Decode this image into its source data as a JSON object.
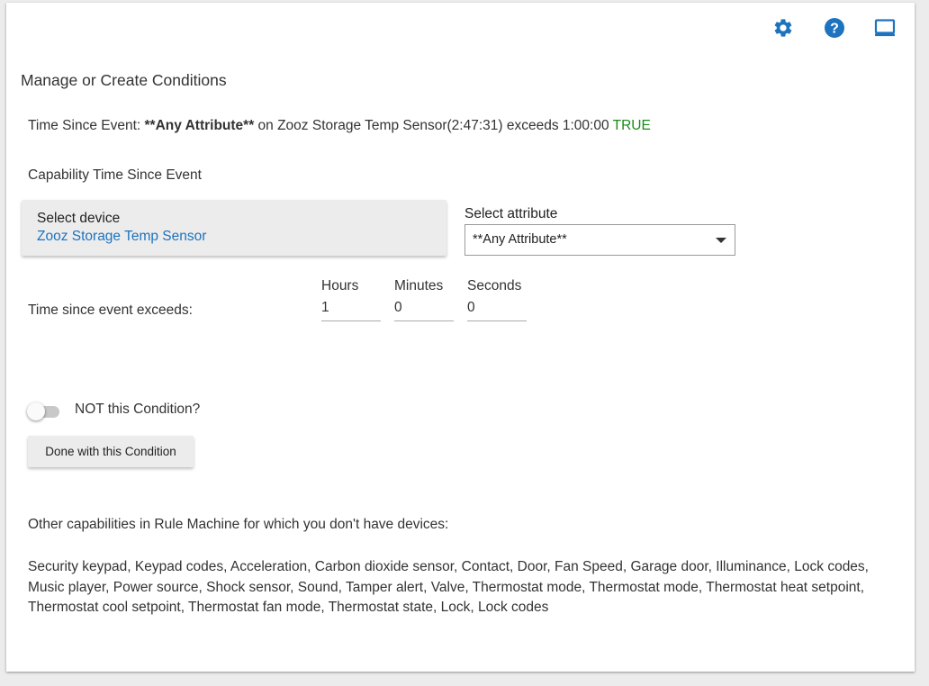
{
  "header": {
    "icons": [
      {
        "name": "gear-icon",
        "color": "#1e73be"
      },
      {
        "name": "help-icon",
        "color": "#1e73be"
      },
      {
        "name": "laptop-icon",
        "color": "#1e73be"
      }
    ]
  },
  "page": {
    "title": "Manage or Create Conditions"
  },
  "summary": {
    "prefix": "Time Since Event: ",
    "attribute": "**Any Attribute**",
    "middle": " on Zooz Storage Temp Sensor(2:47:31) exceeds 1:00:00 ",
    "result": "TRUE"
  },
  "capability": {
    "label": "Capability Time Since Event"
  },
  "device_select": {
    "label": "Select device",
    "value": "Zooz Storage Temp Sensor"
  },
  "attribute_select": {
    "label": "Select attribute",
    "value": "**Any Attribute**"
  },
  "time_since": {
    "label": "Time since event exceeds:",
    "hours": {
      "label": "Hours",
      "value": "1"
    },
    "minutes": {
      "label": "Minutes",
      "value": "0"
    },
    "seconds": {
      "label": "Seconds",
      "value": "0"
    }
  },
  "not_toggle": {
    "label": "NOT this Condition?",
    "on": false
  },
  "done_button": {
    "label": "Done with this Condition"
  },
  "other": {
    "heading": "Other capabilities in Rule Machine for which you don't have devices:",
    "list": "Security keypad, Keypad codes, Acceleration, Carbon dioxide sensor, Contact, Door, Fan Speed, Garage door, Illuminance, Lock codes, Music player, Power source, Shock sensor, Sound, Tamper alert, Valve, Thermostat mode, Thermostat mode, Thermostat heat setpoint, Thermostat cool setpoint, Thermostat fan mode, Thermostat state, Lock, Lock codes"
  },
  "colors": {
    "accent": "#1e73be",
    "true": "#1a8a1a"
  }
}
